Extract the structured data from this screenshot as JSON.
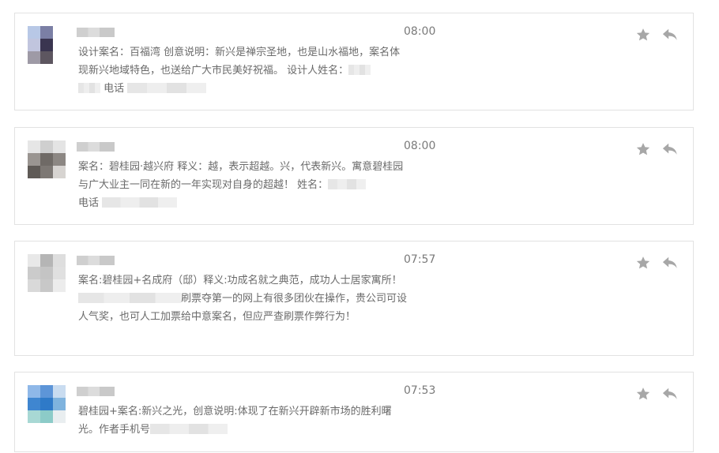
{
  "colors": {
    "icon": "#a7a7a7",
    "border": "#e2e2e2",
    "text": "#6a6a6a"
  },
  "icons": {
    "favorite": "star-icon",
    "reply": "reply-icon"
  },
  "messages": [
    {
      "time": "08:00",
      "parts": [
        "设计案名：百福湾 创意说明：新兴是禅宗圣地，也是山水福地，案名体现新兴地域特色，也送给广大市民美好祝福。 设计人姓名：",
        "",
        " 电话",
        ""
      ],
      "avatar": [
        "#b8c8e6",
        "#7b7fa5",
        "#ffffff",
        "#c1c5de",
        "#3a3550",
        "#ffffff",
        "#9e9aa6",
        "#5d5660",
        "#ffffff"
      ]
    },
    {
      "time": "08:00",
      "parts": [
        "案名：碧桂园·越兴府 释义：越，表示超越。兴，代表新兴。寓意碧桂园与广大业主一同在新的一年实现对自身的超越！ 姓名：",
        "",
        "\n电话",
        ""
      ],
      "avatar": [
        "#e6e6e6",
        "#cfcfcf",
        "#e4e4e4",
        "#9a9591",
        "#6f6a66",
        "#8c8783",
        "#5f5a56",
        "#7d7874",
        "#d7d4d1"
      ]
    },
    {
      "time": "07:57",
      "parts": [
        "案名:碧桂园+名成府（邸）释义:功成名就之典范，成功人士居家寓所！ ",
        "",
        "刷票夺第一的网上有很多团伙在操作，贵公司可设人气奖，也可人工加票给中意案名，但应严查刷票作弊行为！",
        ""
      ],
      "avatar": [
        "#e8e8e8",
        "#b5b5b5",
        "#dedede",
        "#cbcbcb",
        "#c4c4c4",
        "#e0e0e0",
        "#d9d9d9",
        "#c8c8c8",
        "#ececec"
      ]
    },
    {
      "time": "07:53",
      "parts": [
        "碧桂园+案名:新兴之光，创意说明:体现了在新兴开辟新市场的胜利曙光。作者手机号",
        "",
        "",
        ""
      ],
      "avatar": [
        "#8fb8e8",
        "#5d95d8",
        "#c9dcf0",
        "#3f86d0",
        "#2f7ac8",
        "#7fb3de",
        "#a8d8d4",
        "#8ccbc8",
        "#e9eef0"
      ]
    }
  ]
}
